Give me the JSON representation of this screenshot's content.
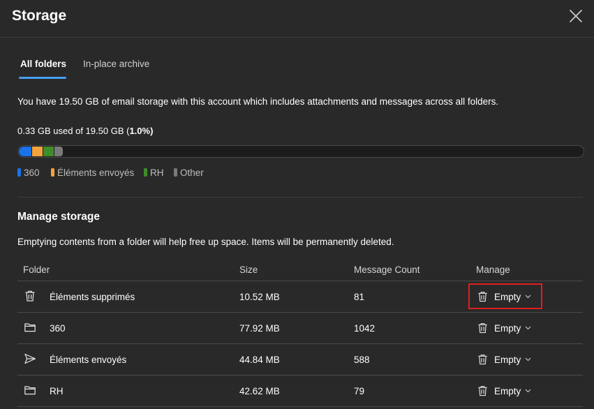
{
  "dialog": {
    "title": "Storage"
  },
  "tabs": [
    {
      "label": "All folders",
      "active": true
    },
    {
      "label": "In-place archive",
      "active": false
    }
  ],
  "storage": {
    "intro": "You have 19.50 GB of email storage with this account which includes attachments and messages across all folders.",
    "usage_text": "0.33 GB used of 19.50 GB (",
    "usage_percent": "1.0%",
    "usage_close": ")",
    "used_fraction": 0.0166,
    "segments": [
      {
        "name": "360",
        "color": "#1a73e8",
        "fraction": 0.3
      },
      {
        "name": "Éléments envoyés",
        "color": "#f2a33c",
        "fraction": 0.25
      },
      {
        "name": "RH",
        "color": "#3f8d2a",
        "fraction": 0.25
      },
      {
        "name": "Other",
        "color": "#7a7a7a",
        "fraction": 0.2
      }
    ]
  },
  "legend": [
    {
      "label": "360",
      "color": "#1a73e8"
    },
    {
      "label": "Éléments envoyés",
      "color": "#f2a33c"
    },
    {
      "label": "RH",
      "color": "#3f8d2a"
    },
    {
      "label": "Other",
      "color": "#7a7a7a"
    }
  ],
  "manage": {
    "heading": "Manage storage",
    "description": "Emptying contents from a folder will help free up space. Items will be permanently deleted.",
    "columns": {
      "folder": "Folder",
      "size": "Size",
      "count": "Message Count",
      "manage": "Manage"
    },
    "rows": [
      {
        "icon": "trash-icon",
        "name": "Éléments supprimés",
        "size": "10.52 MB",
        "count": "81",
        "action": "Empty",
        "highlighted": true
      },
      {
        "icon": "folder-icon",
        "name": "360",
        "size": "77.92 MB",
        "count": "1042",
        "action": "Empty",
        "highlighted": false
      },
      {
        "icon": "send-icon",
        "name": "Éléments envoyés",
        "size": "44.84 MB",
        "count": "588",
        "action": "Empty",
        "highlighted": false
      },
      {
        "icon": "folder-icon",
        "name": "RH",
        "size": "42.62 MB",
        "count": "79",
        "action": "Empty",
        "highlighted": false
      }
    ]
  },
  "colors": {
    "background": "#292929",
    "accent": "#479ef5",
    "highlight": "#e01e1e"
  }
}
